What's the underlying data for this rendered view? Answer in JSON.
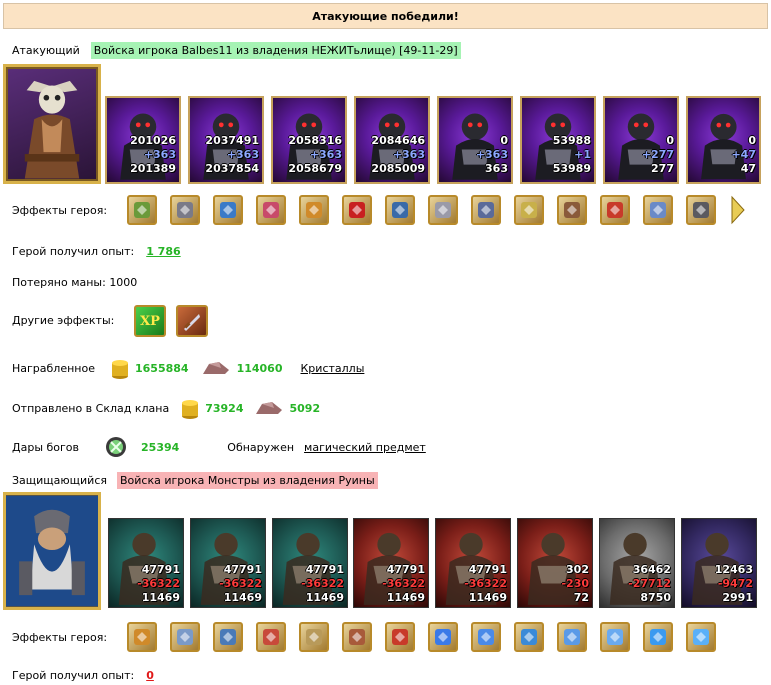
{
  "banner": {
    "title": "Атакующие победили!"
  },
  "attacker": {
    "label": "Атакующий",
    "army": "Войска игрока Balbes11 из владения НЕЖИТьлище) [49-11-29]",
    "units": [
      {
        "top": "201026",
        "mid": "+363",
        "bot": "201389"
      },
      {
        "top": "2037491",
        "mid": "+363",
        "bot": "2037854"
      },
      {
        "top": "2058316",
        "mid": "+363",
        "bot": "2058679"
      },
      {
        "top": "2084646",
        "mid": "+363",
        "bot": "2085009"
      },
      {
        "top": "0",
        "mid": "+363",
        "bot": "363"
      },
      {
        "top": "53988",
        "mid": "+1",
        "bot": "53989"
      },
      {
        "top": "0",
        "mid": "+277",
        "bot": "277"
      },
      {
        "top": "0",
        "mid": "+47",
        "bot": "47"
      }
    ],
    "effects_label": "Эффекты героя:",
    "effects_icons": [
      "boots-icon",
      "mail-icon",
      "gems-icon",
      "scroll-icon",
      "chest-icon",
      "heart-icon",
      "shield-icon",
      "barrel-icon",
      "amulet-icon",
      "crown-icon",
      "ring-icon",
      "socks-icon",
      "glove-icon",
      "lamp-icon"
    ],
    "xp_label": "Герой получил опыт:",
    "xp_value": "1 786",
    "mana_text": "Потеряно маны: 1000",
    "other_effects_label": "Другие эффекты:",
    "loot_label": "Награбленное",
    "loot_gold": "1655884",
    "loot_ore": "114060",
    "loot_crystals": "Кристаллы",
    "clan_label": "Отправлено в Склад клана",
    "clan_gold": "73924",
    "clan_ore": "5092",
    "gifts_label": "Дары богов",
    "gifts_value": "25394",
    "found_label": "Обнаружен",
    "found_link": "магический предмет"
  },
  "defender": {
    "label": "Защищающийся",
    "army": "Войска игрока Монстры из владения Руины",
    "units": [
      {
        "top": "47791",
        "mid": "-36322",
        "bot": "11469"
      },
      {
        "top": "47791",
        "mid": "-36322",
        "bot": "11469"
      },
      {
        "top": "47791",
        "mid": "-36322",
        "bot": "11469"
      },
      {
        "top": "47791",
        "mid": "-36322",
        "bot": "11469"
      },
      {
        "top": "47791",
        "mid": "-36322",
        "bot": "11469"
      },
      {
        "top": "302",
        "mid": "-230",
        "bot": "72"
      },
      {
        "top": "36462",
        "mid": "-27712",
        "bot": "8750"
      },
      {
        "top": "12463",
        "mid": "-9472",
        "bot": "2991"
      }
    ],
    "effects_label": "Эффекты героя:",
    "effects_icons": [
      "helmet-icon",
      "arrows-icon",
      "shield-icon",
      "armor-icon",
      "mask-icon",
      "axes-icon",
      "fire-head-icon",
      "blue-fist-icon",
      "blue-armor-icon",
      "blue-ring-icon",
      "blue-pick-icon",
      "blue-hammer-icon",
      "blue-spark-icon",
      "snowflake-icon"
    ],
    "xp_label": "Герой получил опыт:",
    "xp_value": "0"
  }
}
